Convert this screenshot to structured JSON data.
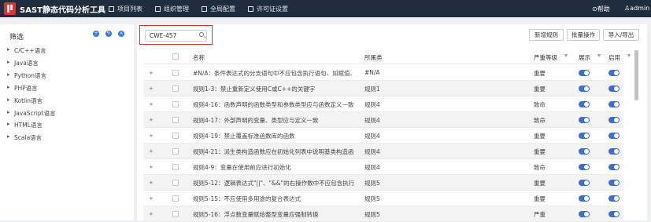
{
  "header": {
    "title": "SAST静态代码分析工具",
    "nav": [
      "项目列表",
      "组织管理",
      "全局配置",
      "许可证设置"
    ],
    "help": "帮助",
    "user": "admin"
  },
  "sidebar": {
    "title": "筛选",
    "languages": [
      "C/C++语言",
      "Java语言",
      "Python语言",
      "PHP语言",
      "Kotlin语言",
      "JavaScript语言",
      "HTML语言",
      "Scala语言"
    ]
  },
  "toolbar": {
    "search_value": "CWE-457",
    "new_rule": "新增规则",
    "batch_op": "批量操作",
    "import_export": "导入/导出"
  },
  "table": {
    "columns": [
      "名称",
      "所属类",
      "严重等级",
      "展示",
      "启用"
    ],
    "rows": [
      {
        "name": "#N/A：条件表达式的分支语句中不应包含执行语句，如赋值、函...",
        "category": "#N/A",
        "severity": "重要",
        "display": true,
        "enabled": true
      },
      {
        "name": "规则1-3：禁止重新定义使用C或C++的关键字",
        "category": "规则1",
        "severity": "重要",
        "display": true,
        "enabled": true
      },
      {
        "name": "规则4-16：函数声明的函数类型和参数类型应与函数定义一致",
        "category": "规则4",
        "severity": "致命",
        "display": true,
        "enabled": true
      },
      {
        "name": "规则4-17：外部声明的变量、类型应与定义一致",
        "category": "规则4",
        "severity": "致命",
        "display": true,
        "enabled": true
      },
      {
        "name": "规则4-19：禁止覆盖标准函数库的函数",
        "category": "规则4",
        "severity": "重要",
        "display": true,
        "enabled": true
      },
      {
        "name": "规则4-21：派生类构造函数应在初始化列表中说明基类构造函数",
        "category": "规则4",
        "severity": "重要",
        "display": true,
        "enabled": true
      },
      {
        "name": "规则4-9：变量在使用前应进行初始化",
        "category": "规则4",
        "severity": "致命",
        "display": true,
        "enabled": true
      },
      {
        "name": "规则5-12：逻辑表达式\"||\"、\"&&\"的右操作数中不应包含执行语...",
        "category": "规则5",
        "severity": "重要",
        "display": true,
        "enabled": true
      },
      {
        "name": "规则5-15：不应使用多用途的复合表达式",
        "category": "规则5",
        "severity": "重要",
        "display": true,
        "enabled": true
      },
      {
        "name": "规则5-16：浮点数变量赋给整型变量应强制转换",
        "category": "规则5",
        "severity": "严重",
        "display": true,
        "enabled": true
      }
    ]
  }
}
